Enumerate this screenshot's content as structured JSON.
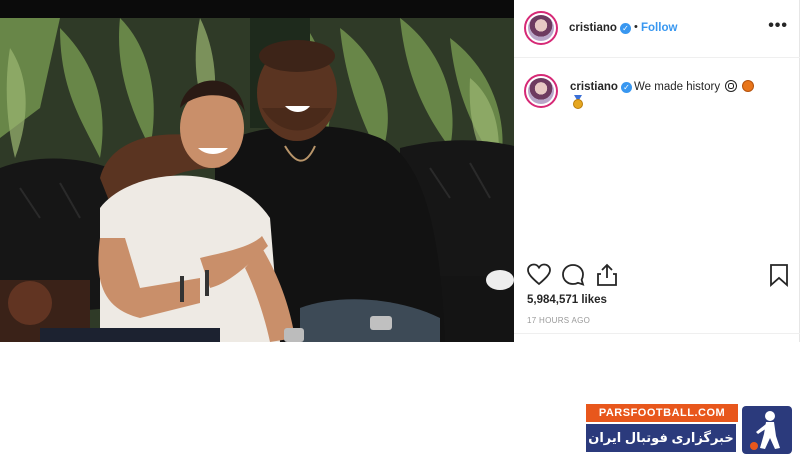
{
  "post": {
    "username": "cristiano",
    "follow_label": "Follow",
    "separator": "•",
    "more_label": "•••",
    "caption": "We made history",
    "likes": "5,984,571 likes",
    "timestamp": "17 HOURS AGO",
    "verified_mark": "✓"
  },
  "icons": {
    "like": "heart-icon",
    "comment": "comment-icon",
    "share": "share-icon",
    "save": "bookmark-icon"
  },
  "watermark": {
    "top_text": "PARSFOOTBALL.COM",
    "bottom_text": "خبرگزاری فوتبال ایران"
  },
  "colors": {
    "link_blue": "#3897f0",
    "verified_blue": "#3897f0",
    "watermark_orange": "#e8571c",
    "watermark_navy": "#2b3a7c"
  }
}
